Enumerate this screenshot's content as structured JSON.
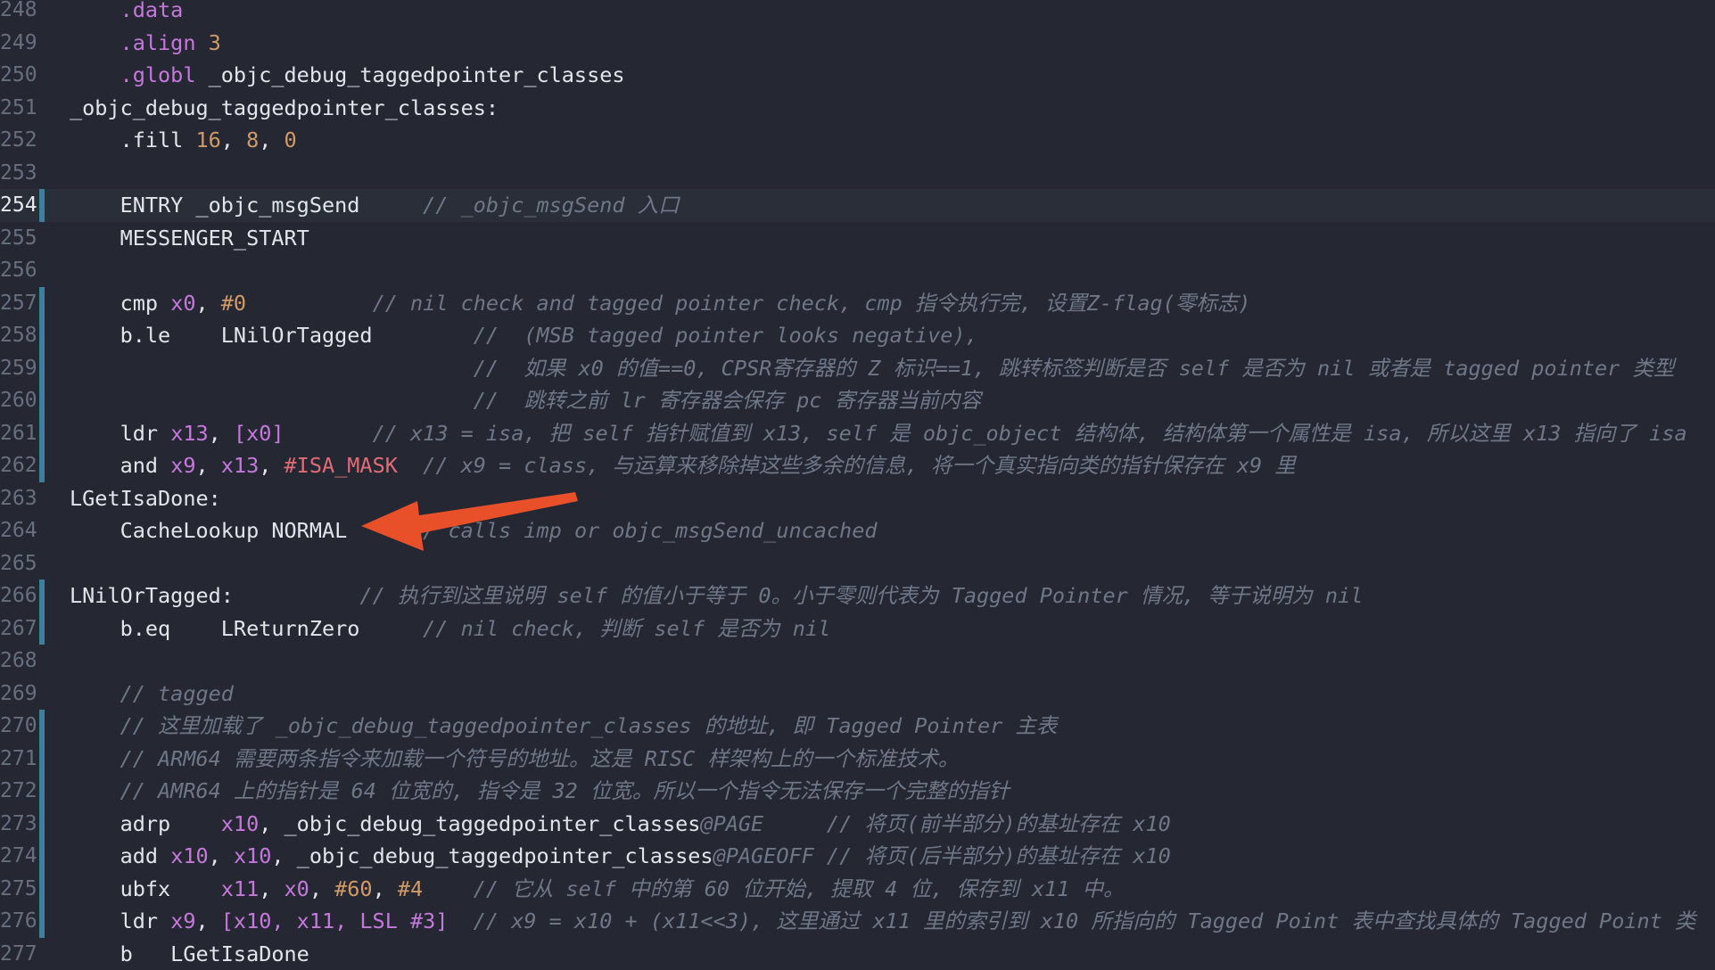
{
  "editor": {
    "lines": [
      {
        "num": "248",
        "tokens": [
          {
            "t": "    "
          },
          {
            "t": ".data",
            "c": "kw"
          }
        ]
      },
      {
        "num": "249",
        "tokens": [
          {
            "t": "    "
          },
          {
            "t": ".align",
            "c": "kw"
          },
          {
            "t": " "
          },
          {
            "t": "3",
            "c": "num"
          }
        ]
      },
      {
        "num": "250",
        "tokens": [
          {
            "t": "    "
          },
          {
            "t": ".globl",
            "c": "kw"
          },
          {
            "t": " _objc_debug_taggedpointer_classes"
          }
        ]
      },
      {
        "num": "251",
        "tokens": [
          {
            "t": "_objc_debug_taggedpointer_classes:"
          }
        ]
      },
      {
        "num": "252",
        "tokens": [
          {
            "t": "    .fill "
          },
          {
            "t": "16",
            "c": "num"
          },
          {
            "t": ", "
          },
          {
            "t": "8",
            "c": "num"
          },
          {
            "t": ", "
          },
          {
            "t": "0",
            "c": "num"
          }
        ]
      },
      {
        "num": "253",
        "tokens": []
      },
      {
        "num": "254",
        "current": true,
        "mark": true,
        "tokens": [
          {
            "t": "    ENTRY _objc_msgSend     "
          },
          {
            "t": "// _objc_msgSend 入口",
            "c": "comment"
          }
        ]
      },
      {
        "num": "255",
        "tokens": [
          {
            "t": "    MESSENGER_START"
          }
        ]
      },
      {
        "num": "256",
        "tokens": []
      },
      {
        "num": "257",
        "mark": true,
        "tokens": [
          {
            "t": "    cmp "
          },
          {
            "t": "x0",
            "c": "reg"
          },
          {
            "t": ", "
          },
          {
            "t": "#0",
            "c": "hash"
          },
          {
            "t": "          "
          },
          {
            "t": "// nil check and tagged pointer check, cmp 指令执行完, 设置Z-flag(零标志)",
            "c": "comment"
          }
        ]
      },
      {
        "num": "258",
        "mark": true,
        "tokens": [
          {
            "t": "    b.le    LNilOrTagged        "
          },
          {
            "t": "//  (MSB tagged pointer looks negative),",
            "c": "comment"
          }
        ]
      },
      {
        "num": "259",
        "mark": true,
        "tokens": [
          {
            "t": "                                "
          },
          {
            "t": "//  如果 x0 的值==0, CPSR寄存器的 Z 标识==1, 跳转标签判断是否 self 是否为 nil 或者是 tagged pointer 类型",
            "c": "comment"
          }
        ]
      },
      {
        "num": "260",
        "mark": true,
        "tokens": [
          {
            "t": "                                "
          },
          {
            "t": "//  跳转之前 lr 寄存器会保存 pc 寄存器当前内容",
            "c": "comment"
          }
        ]
      },
      {
        "num": "261",
        "mark": true,
        "tokens": [
          {
            "t": "    ldr "
          },
          {
            "t": "x13",
            "c": "reg"
          },
          {
            "t": ", "
          },
          {
            "t": "[x0]",
            "c": "reg"
          },
          {
            "t": "       "
          },
          {
            "t": "// x13 = isa, 把 self 指针赋值到 x13, self 是 objc_object 结构体, 结构体第一个属性是 isa, 所以这里 x13 指向了 isa",
            "c": "comment"
          }
        ]
      },
      {
        "num": "262",
        "mark": true,
        "tokens": [
          {
            "t": "    and "
          },
          {
            "t": "x9",
            "c": "reg"
          },
          {
            "t": ", "
          },
          {
            "t": "x13",
            "c": "reg"
          },
          {
            "t": ", "
          },
          {
            "t": "#ISA_MASK",
            "c": "macro"
          },
          {
            "t": "  "
          },
          {
            "t": "// x9 = class, 与运算来移除掉这些多余的信息, 将一个真实指向类的指针保存在 x9 里",
            "c": "comment"
          }
        ]
      },
      {
        "num": "263",
        "tokens": [
          {
            "t": "LGetIsaDone:"
          }
        ]
      },
      {
        "num": "264",
        "tokens": [
          {
            "t": "    CacheLookup NORMAL     "
          },
          {
            "t": "// calls imp or objc_msgSend_uncached",
            "c": "comment"
          }
        ]
      },
      {
        "num": "265",
        "tokens": []
      },
      {
        "num": "266",
        "mark": true,
        "tokens": [
          {
            "t": "LNilOrTagged:          "
          },
          {
            "t": "// 执行到这里说明 self 的值小于等于 0。小于零则代表为 Tagged Pointer 情况, 等于说明为 nil",
            "c": "comment"
          }
        ]
      },
      {
        "num": "267",
        "mark": true,
        "tokens": [
          {
            "t": "    b.eq    LReturnZero     "
          },
          {
            "t": "// nil check, 判断 self 是否为 nil",
            "c": "comment"
          }
        ]
      },
      {
        "num": "268",
        "tokens": []
      },
      {
        "num": "269",
        "tokens": [
          {
            "t": "    "
          },
          {
            "t": "// tagged",
            "c": "comment"
          }
        ]
      },
      {
        "num": "270",
        "mark": true,
        "tokens": [
          {
            "t": "    "
          },
          {
            "t": "// 这里加载了 _objc_debug_taggedpointer_classes 的地址, 即 Tagged Pointer 主表",
            "c": "comment"
          }
        ]
      },
      {
        "num": "271",
        "mark": true,
        "tokens": [
          {
            "t": "    "
          },
          {
            "t": "// ARM64 需要两条指令来加载一个符号的地址。这是 RISC 样架构上的一个标准技术。",
            "c": "comment"
          }
        ]
      },
      {
        "num": "272",
        "mark": true,
        "tokens": [
          {
            "t": "    "
          },
          {
            "t": "// AMR64 上的指针是 64 位宽的, 指令是 32 位宽。所以一个指令无法保存一个完整的指针",
            "c": "comment"
          }
        ]
      },
      {
        "num": "273",
        "mark": true,
        "tokens": [
          {
            "t": "    adrp    "
          },
          {
            "t": "x10",
            "c": "reg"
          },
          {
            "t": ", _objc_debug_taggedpointer_classes"
          },
          {
            "t": "@PAGE",
            "c": "comment"
          },
          {
            "t": "     "
          },
          {
            "t": "// 将页(前半部分)的基址存在 x10",
            "c": "comment"
          }
        ]
      },
      {
        "num": "274",
        "mark": true,
        "tokens": [
          {
            "t": "    add "
          },
          {
            "t": "x10",
            "c": "reg"
          },
          {
            "t": ", "
          },
          {
            "t": "x10",
            "c": "reg"
          },
          {
            "t": ", _objc_debug_taggedpointer_classes"
          },
          {
            "t": "@PAGEOFF",
            "c": "comment"
          },
          {
            "t": " "
          },
          {
            "t": "// 将页(后半部分)的基址存在 x10",
            "c": "comment"
          }
        ]
      },
      {
        "num": "275",
        "mark": true,
        "tokens": [
          {
            "t": "    ubfx    "
          },
          {
            "t": "x11",
            "c": "reg"
          },
          {
            "t": ", "
          },
          {
            "t": "x0",
            "c": "reg"
          },
          {
            "t": ", "
          },
          {
            "t": "#60",
            "c": "hash"
          },
          {
            "t": ", "
          },
          {
            "t": "#4",
            "c": "hash"
          },
          {
            "t": "    "
          },
          {
            "t": "// 它从 self 中的第 60 位开始, 提取 4 位, 保存到 x11 中。",
            "c": "comment"
          }
        ]
      },
      {
        "num": "276",
        "mark": true,
        "tokens": [
          {
            "t": "    ldr "
          },
          {
            "t": "x9",
            "c": "reg"
          },
          {
            "t": ", "
          },
          {
            "t": "[x10, x11, LSL #3]",
            "c": "reg"
          },
          {
            "t": "  "
          },
          {
            "t": "// x9 = x10 + (x11<<3), 这里通过 x11 里的索引到 x10 所指向的 Tagged Point 表中查找具体的 Tagged Point 类",
            "c": "comment"
          }
        ]
      },
      {
        "num": "277",
        "tokens": [
          {
            "t": "    b   LGetIsaDone"
          }
        ]
      }
    ]
  },
  "annotation": {
    "arrow_color": "#e8502a"
  }
}
